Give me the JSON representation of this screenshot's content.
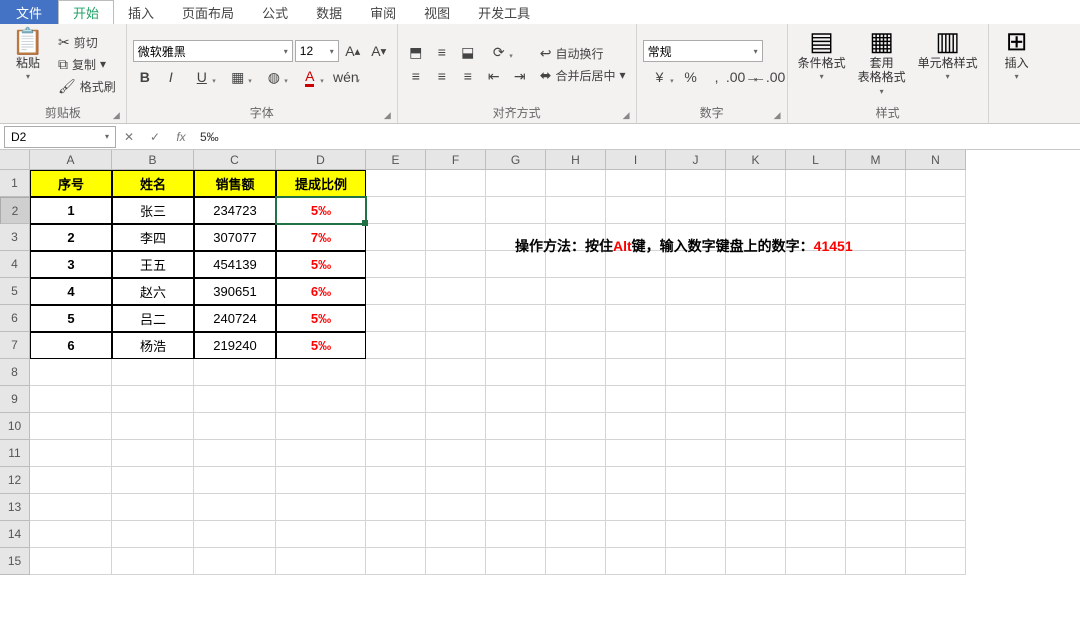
{
  "tabs": {
    "file": "文件",
    "home": "开始",
    "insert": "插入",
    "layout": "页面布局",
    "formula": "公式",
    "data": "数据",
    "review": "审阅",
    "view": "视图",
    "dev": "开发工具"
  },
  "ribbon": {
    "clipboard": {
      "paste": "粘贴",
      "cut": "剪切",
      "copy": "复制",
      "painter": "格式刷",
      "title": "剪贴板"
    },
    "font": {
      "name": "微软雅黑",
      "size": "12",
      "title": "字体"
    },
    "align": {
      "wrap": "自动换行",
      "merge": "合并后居中",
      "title": "对齐方式"
    },
    "number": {
      "format": "常规",
      "title": "数字"
    },
    "styles": {
      "cond": "条件格式",
      "table": "套用\n表格格式",
      "cell": "单元格样式",
      "title": "样式"
    },
    "insert_btn": "插入"
  },
  "formula_bar": {
    "name": "D2",
    "fx": "fx",
    "value": "5‰"
  },
  "columns": [
    "A",
    "B",
    "C",
    "D",
    "E",
    "F",
    "G",
    "H",
    "I",
    "J",
    "K",
    "L",
    "M",
    "N"
  ],
  "row_count": 15,
  "headers": [
    "序号",
    "姓名",
    "销售额",
    "提成比例"
  ],
  "table": [
    {
      "id": "1",
      "name": "张三",
      "sales": "234723",
      "ratio": "5‰"
    },
    {
      "id": "2",
      "name": "李四",
      "sales": "307077",
      "ratio": "7‰"
    },
    {
      "id": "3",
      "name": "王五",
      "sales": "454139",
      "ratio": "5‰"
    },
    {
      "id": "4",
      "name": "赵六",
      "sales": "390651",
      "ratio": "6‰"
    },
    {
      "id": "5",
      "name": "吕二",
      "sales": "240724",
      "ratio": "5‰"
    },
    {
      "id": "6",
      "name": "杨浩",
      "sales": "219240",
      "ratio": "5‰"
    }
  ],
  "note": {
    "p1": "操作方法：按住",
    "alt": "Alt",
    "p2": "键，输入数字键盘上的数字：",
    "code": "41451"
  },
  "active_cell": "D2"
}
